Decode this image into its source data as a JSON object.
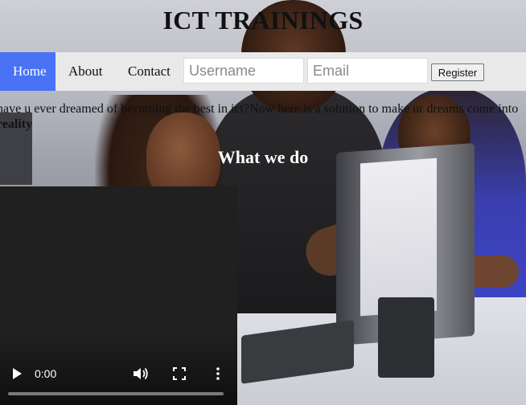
{
  "header": {
    "title": "ICT TRAININGS"
  },
  "nav": {
    "home": "Home",
    "about": "About",
    "contact": "Contact",
    "username_placeholder": "Username",
    "email_placeholder": "Email",
    "register": "Register",
    "active_color": "#4a72f5"
  },
  "main": {
    "intro_text": "have u ever dreamed of becoming the best in ict?Now here is a solution to make ur dreams come into",
    "intro_bold": "reality",
    "heading": "What we do"
  },
  "video": {
    "time": "0:00",
    "progress": 0,
    "icons": [
      "play-icon",
      "volume-icon",
      "fullscreen-icon",
      "more-options-icon"
    ]
  }
}
